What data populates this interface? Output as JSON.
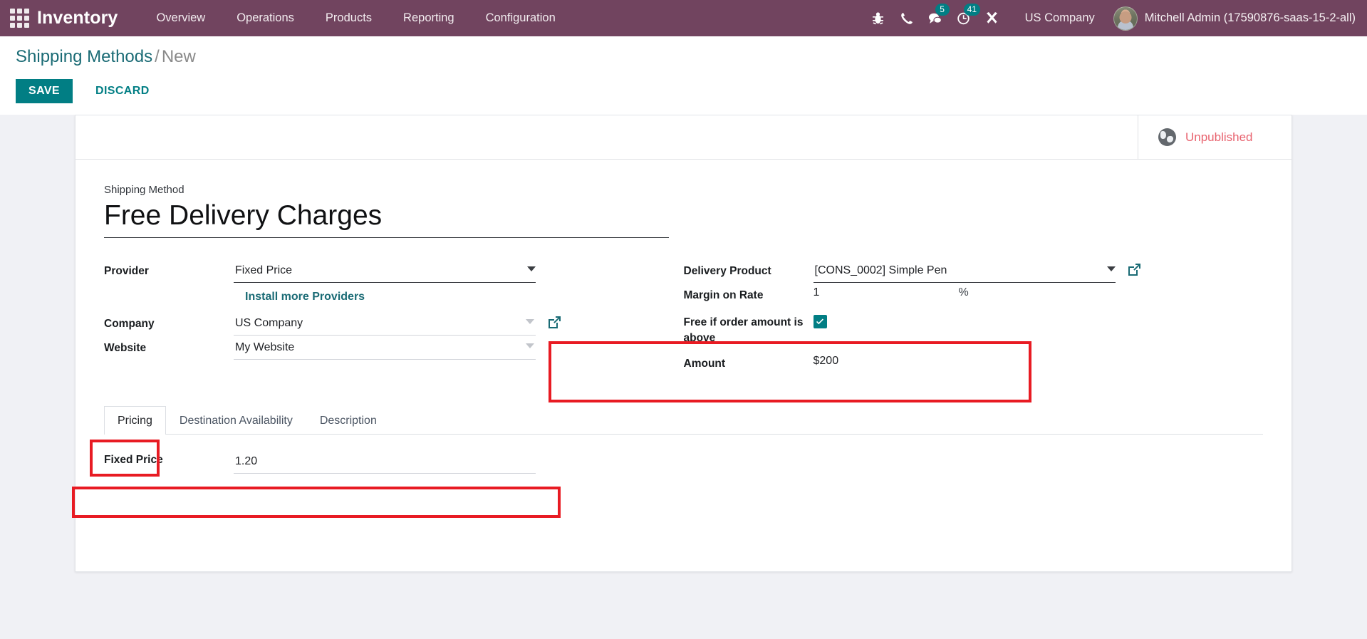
{
  "navbar": {
    "apps_icon": "apps-grid-icon",
    "brand": "Inventory",
    "menu": [
      {
        "label": "Overview"
      },
      {
        "label": "Operations"
      },
      {
        "label": "Products"
      },
      {
        "label": "Reporting"
      },
      {
        "label": "Configuration"
      }
    ],
    "icons": [
      {
        "name": "bug-icon",
        "label": "Debug"
      },
      {
        "name": "phone-icon",
        "label": "VOIP"
      },
      {
        "name": "messages-icon",
        "label": "Messages",
        "badge": "5"
      },
      {
        "name": "activities-clock-icon",
        "label": "Activities",
        "badge": "41"
      },
      {
        "name": "wrench-icon",
        "label": "Tools"
      }
    ],
    "company": "US Company",
    "user": "Mitchell Admin (17590876-saas-15-2-all)"
  },
  "control_panel": {
    "breadcrumb_root": "Shipping Methods",
    "breadcrumb_sep": "/",
    "breadcrumb_current": "New",
    "save_label": "SAVE",
    "discard_label": "DISCARD"
  },
  "sheet": {
    "status": {
      "icon": "globe-icon",
      "label": "Unpublished"
    },
    "title_label": "Shipping Method",
    "title_value": "Free Delivery Charges",
    "left_fields": {
      "provider_label": "Provider",
      "provider_value": "Fixed Price",
      "install_providers_link": "Install more Providers",
      "company_label": "Company",
      "company_value": "US Company",
      "website_label": "Website",
      "website_value": "My Website"
    },
    "right_fields": {
      "delivery_product_label": "Delivery Product",
      "delivery_product_value": "[CONS_0002] Simple Pen",
      "margin_label": "Margin on Rate",
      "margin_value": "1",
      "margin_suffix": "%",
      "free_above_label": "Free if order amount is above",
      "free_above_checked": true,
      "amount_label": "Amount",
      "amount_value": "$200"
    },
    "tabs": [
      {
        "label": "Pricing",
        "active": true
      },
      {
        "label": "Destination Availability",
        "active": false
      },
      {
        "label": "Description",
        "active": false
      }
    ],
    "pricing_tab": {
      "fixed_price_label": "Fixed Price",
      "fixed_price_value": "1.20"
    }
  },
  "colors": {
    "navbar": "#71445f",
    "accent_teal": "#017e84",
    "link_teal": "#1a6b75",
    "status_red": "#e8636f",
    "highlight_red": "#e81b23",
    "page_bg": "#f0f1f5"
  }
}
